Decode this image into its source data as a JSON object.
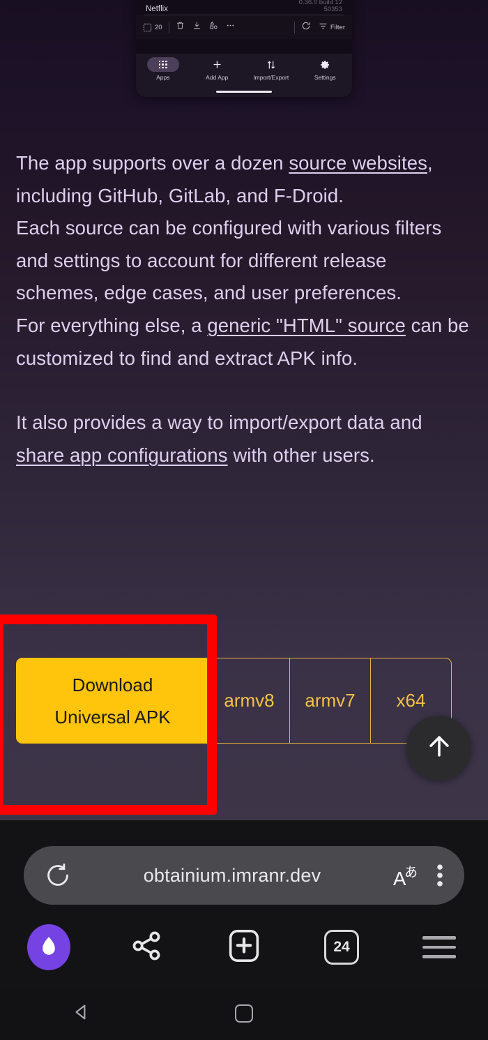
{
  "app_screenshot": {
    "app_name": "Netflix",
    "version_line_1": "0.36.0 build 12",
    "version_line_2": "50353",
    "selected_count": "20",
    "filter_label": "Filter",
    "toolbar_icons": [
      "select-all-icon",
      "delete-icon",
      "download-icon",
      "categories-icon",
      "more-options-icon",
      "refresh-icon",
      "filter-icon"
    ],
    "nav_items": [
      {
        "label": "Apps",
        "icon": "apps-grid-icon",
        "active": true
      },
      {
        "label": "Add App",
        "icon": "plus-icon",
        "active": false
      },
      {
        "label": "Import/Export",
        "icon": "import-export-icon",
        "active": false
      },
      {
        "label": "Settings",
        "icon": "gear-icon",
        "active": false
      }
    ]
  },
  "content": {
    "para1": {
      "before_link": "The app supports over a dozen ",
      "link": "source websites",
      "after_link": ", including GitHub, GitLab, and F-Droid."
    },
    "para2": "Each source can be configured with various filters and settings to account for different release schemes, edge cases, and user preferences.",
    "para3": {
      "before_link": "For everything else, a ",
      "link": "generic \"HTML\" source",
      "after_link": " can be customized to find and extract APK info."
    },
    "para4": {
      "before_link": "It also provides a way to import/export data and ",
      "link": "share app configurations",
      "after_link": " with other users."
    }
  },
  "download": {
    "primary_line1": "Download",
    "primary_line2": "Universal APK",
    "options": [
      "armv8",
      "armv7",
      "x64"
    ],
    "primary_color": "#FFC40C",
    "option_border_color": "#e8b33c",
    "option_text_color": "#f5c243"
  },
  "annotation": {
    "highlight_color": "#FF0000",
    "target": "download-universal-apk-button"
  },
  "fab": {
    "icon": "arrow-up-icon",
    "label": "scroll to top"
  },
  "browser": {
    "url": "obtainium.imranr.dev",
    "reload_icon": "reload-icon",
    "translate_icon": "translate-icon",
    "menu_icon": "three-dot-menu-icon",
    "bottom_nav": [
      {
        "name": "firefox-logo-button",
        "icon": "firefox-logo-icon"
      },
      {
        "name": "share-button",
        "icon": "share-icon"
      },
      {
        "name": "new-tab-button",
        "icon": "plus-square-icon"
      },
      {
        "name": "tab-switcher-button",
        "icon": "tab-count-icon",
        "count": "24"
      },
      {
        "name": "browser-menu-button",
        "icon": "hamburger-menu-icon"
      }
    ]
  },
  "system_nav": [
    {
      "name": "android-back-button",
      "icon": "back-triangle-icon"
    },
    {
      "name": "android-home-button",
      "icon": "home-square-icon"
    },
    {
      "name": "android-recents-button",
      "icon": "recents-lines-icon"
    }
  ]
}
